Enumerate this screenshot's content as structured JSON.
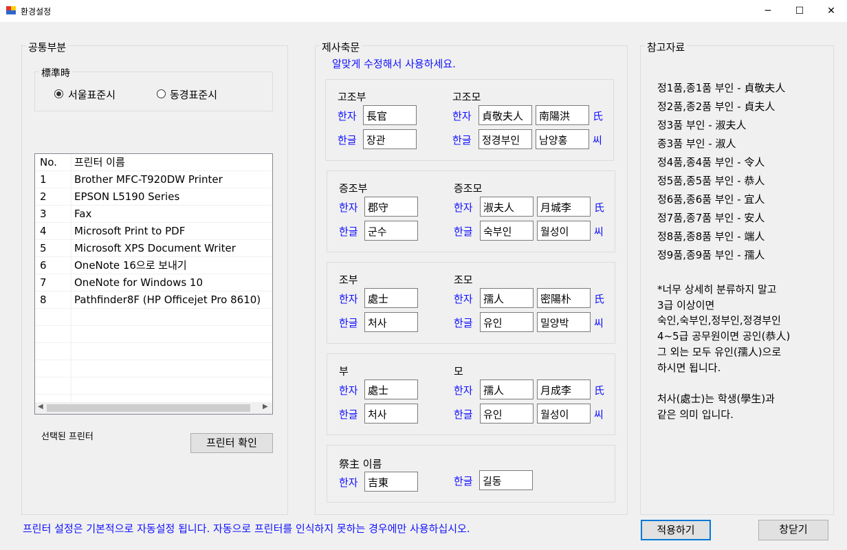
{
  "window": {
    "title": "환경설정",
    "minimize": "─",
    "maximize": "☐",
    "close": "✕"
  },
  "common": {
    "group_label": "공통부분",
    "timezone": {
      "label": "標準時",
      "options": [
        {
          "label": "서울표준시",
          "selected": true
        },
        {
          "label": "동경표준시",
          "selected": false
        }
      ]
    },
    "printers": {
      "headers": [
        "No.",
        "프린터 이름"
      ],
      "rows": [
        [
          "1",
          "Brother MFC-T920DW Printer"
        ],
        [
          "2",
          "EPSON L5190 Series"
        ],
        [
          "3",
          "Fax"
        ],
        [
          "4",
          "Microsoft Print to PDF"
        ],
        [
          "5",
          "Microsoft XPS Document Writer"
        ],
        [
          "6",
          "OneNote 16으로 보내기"
        ],
        [
          "7",
          "OneNote for Windows 10"
        ],
        [
          "8",
          "Pathfinder8F (HP Officejet Pro 8610)"
        ]
      ]
    },
    "selected_printer_label": "선택된 프린터",
    "check_printer_button": "프린터 확인"
  },
  "prayer": {
    "group_label": "제사축문",
    "hint": "알맞게 수정해서 사용하세요.",
    "hanja_label": "한자",
    "hangul_label": "한글",
    "hanja_suffix": "氏",
    "hangul_suffix": "씨",
    "generations": [
      {
        "father_label": "고조부",
        "father_hanja": "長官",
        "father_hangul": "장관",
        "mother_label": "고조모",
        "mother_title_hanja": "貞敬夫人",
        "mother_clan_hanja": "南陽洪",
        "mother_title_hangul": "정경부인",
        "mother_clan_hangul": "남양홍"
      },
      {
        "father_label": "증조부",
        "father_hanja": "郡守",
        "father_hangul": "군수",
        "mother_label": "증조모",
        "mother_title_hanja": "淑夫人",
        "mother_clan_hanja": "月城李",
        "mother_title_hangul": "숙부인",
        "mother_clan_hangul": "월성이"
      },
      {
        "father_label": "조부",
        "father_hanja": "處士",
        "father_hangul": "처사",
        "mother_label": "조모",
        "mother_title_hanja": "孺人",
        "mother_clan_hanja": "密陽朴",
        "mother_title_hangul": "유인",
        "mother_clan_hangul": "밀양박"
      },
      {
        "father_label": "부",
        "father_hanja": "處士",
        "father_hangul": "처사",
        "mother_label": "모",
        "mother_title_hanja": "孺人",
        "mother_clan_hanja": "月成李",
        "mother_title_hangul": "유인",
        "mother_clan_hangul": "월성이"
      }
    ],
    "host": {
      "label": "祭主 이름",
      "hanja": "吉東",
      "hangul": "길동"
    }
  },
  "reference": {
    "group_label": "참고자료",
    "ranks": [
      "정1품,종1품 부인 - 貞敬夫人",
      "정2품,종2품 부인 - 貞夫人",
      "정3품 부인 - 淑夫人",
      "종3품 부인 - 淑人",
      "정4품,종4품 부인 - 令人",
      "정5품,종5품 부인 - 恭人",
      "정6품,종6품 부인 - 宜人",
      "정7품,종7품 부인 - 安人",
      "정8품,종8품 부인 - 端人",
      "정9품,종9품 부인 - 孺人"
    ],
    "notes": [
      "*너무 상세히 분류하지 말고",
      "3급 이상이면",
      "숙인,숙부인,정부인,정경부인",
      "4~5급 공무원이면 공인(恭人)",
      "그 외는 모두 유인(孺人)으로",
      "하시면 됩니다.",
      "",
      "처사(處士)는 학생(學生)과",
      "같은 의미 입니다."
    ]
  },
  "footer": {
    "note": "프린터 설정은 기본적으로 자동설정 됩니다. 자동으로 프린터를 인식하지 못하는 경우에만 사용하십시오.",
    "apply_button": "적용하기",
    "close_button": "창닫기"
  }
}
